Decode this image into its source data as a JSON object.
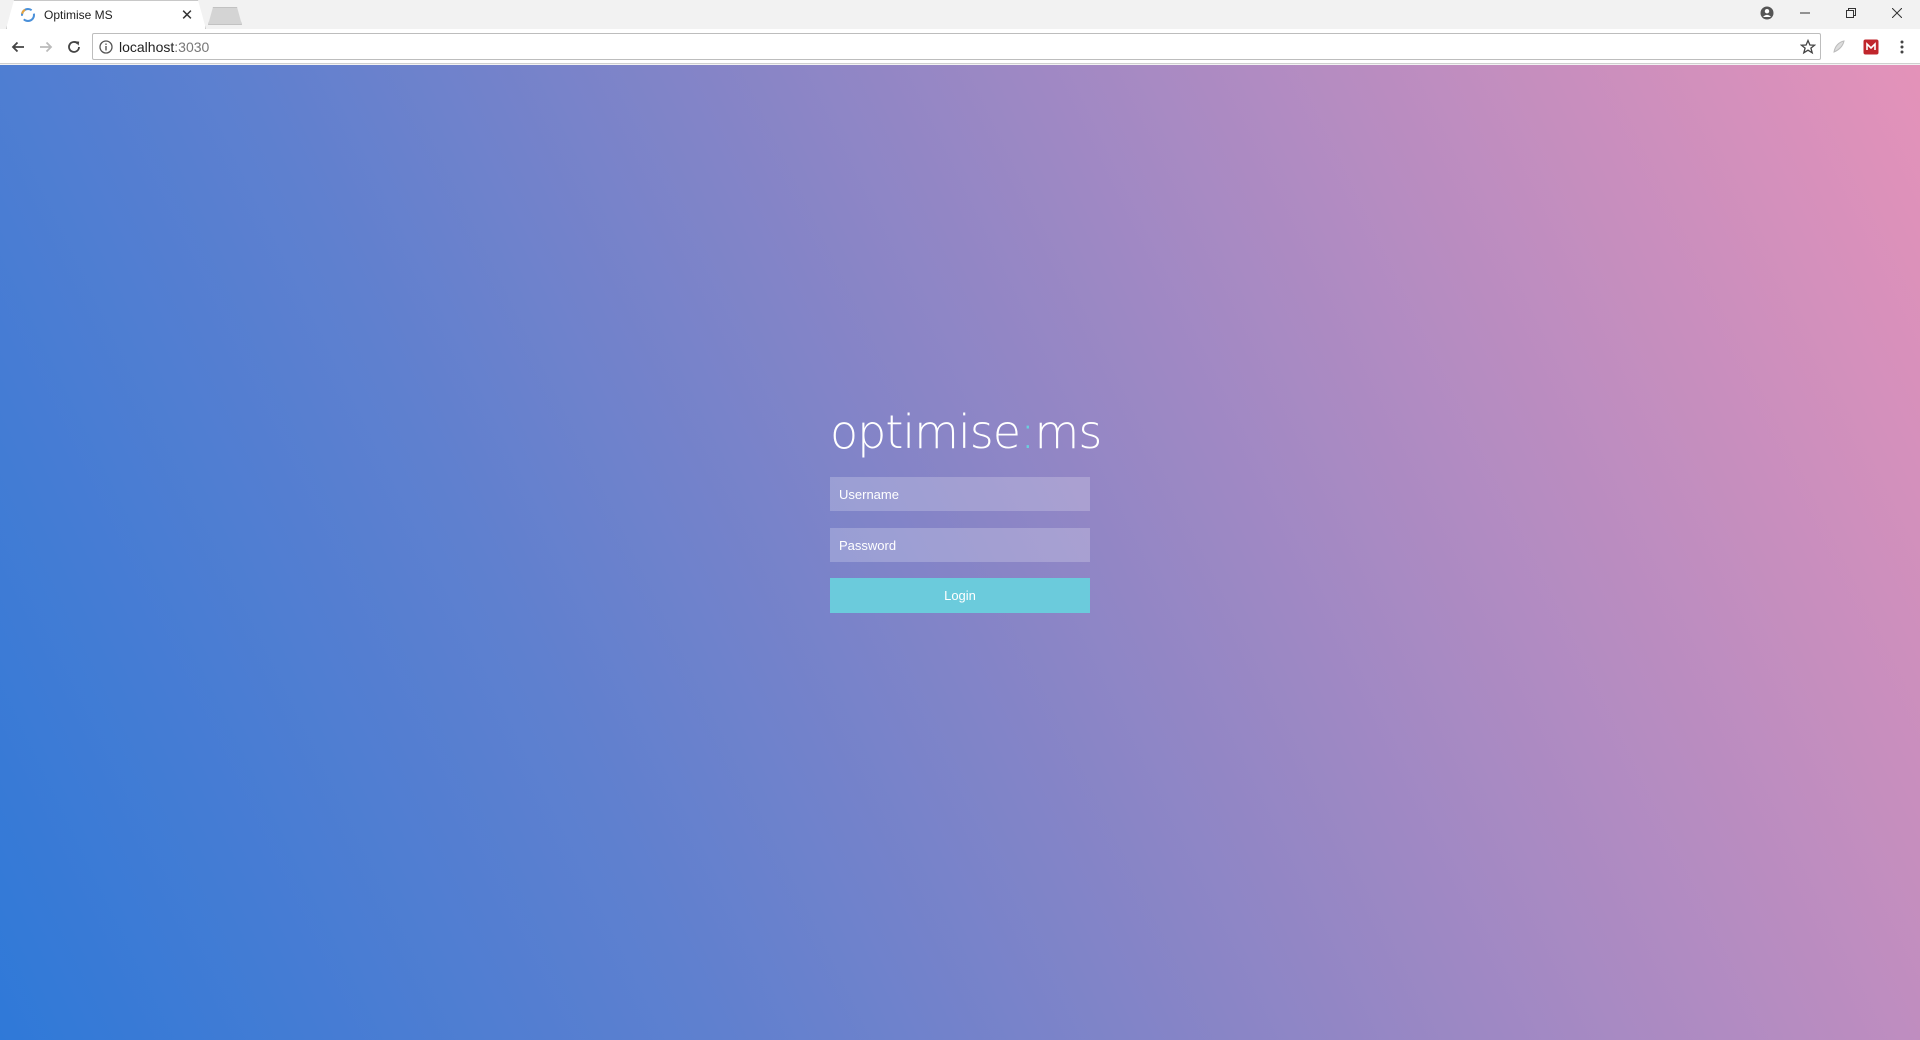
{
  "browser": {
    "tab": {
      "title": "Optimise MS",
      "favicon": "chrome-loading-icon"
    },
    "address_bar": {
      "host": "localhost",
      "port": ":3030"
    },
    "window_controls": [
      "minimize-icon",
      "restore-icon",
      "close-icon"
    ]
  },
  "login": {
    "logo": {
      "text_left": "optimise",
      "separator": ":",
      "text_right": "ms"
    },
    "username_placeholder": "Username",
    "password_placeholder": "Password",
    "submit_label": "Login"
  },
  "colors": {
    "accent": "#6bcbdc",
    "gradient_start": "#2f79d8",
    "gradient_end": "#e492b9"
  }
}
